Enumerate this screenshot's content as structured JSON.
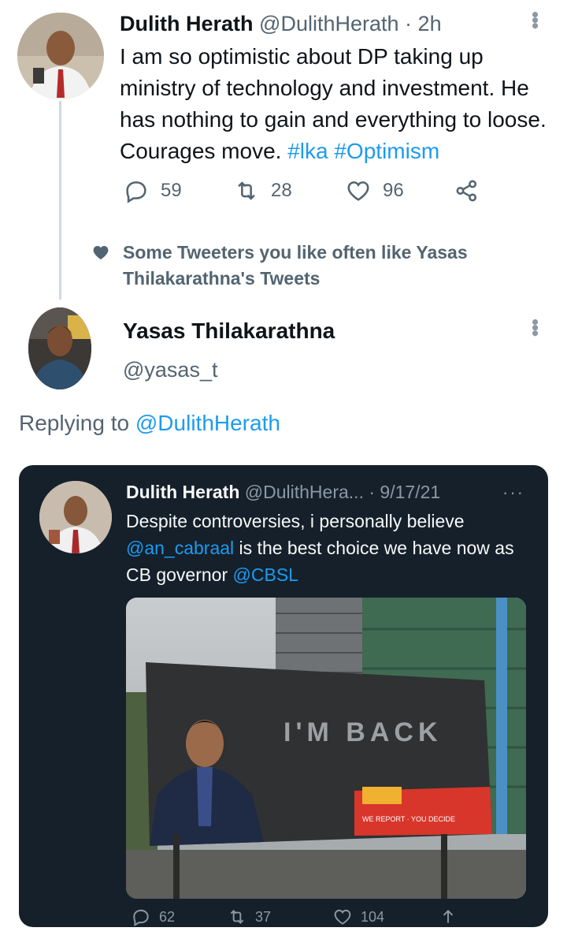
{
  "tweet1": {
    "author_name": "Dulith Herath",
    "author_handle": "@DulithHerath",
    "separator": "·",
    "time": "2h",
    "text_before": "I am so optimistic about DP taking up ministry of technology and investment. He has nothing to gain and everything to loose. Courages move. ",
    "hashtags": "#lka #Optimism",
    "replies": "59",
    "retweets": "28",
    "likes": "96"
  },
  "social_context": {
    "text": "Some Tweeters you like often like Yasas Thilakarathna's Tweets"
  },
  "tweet2": {
    "author_name": "Yasas Thilakarathna",
    "author_handle": "@yasas_t",
    "replying_prefix": "Replying to ",
    "replying_to": "@DulithHerath"
  },
  "embedded": {
    "author_name": "Dulith Herath",
    "author_handle": "@DulithHera...",
    "separator": "·",
    "date": "9/17/21",
    "more": "···",
    "text_1": "Despite controversies, i personally believe ",
    "mention_1": "@an_cabraal",
    "text_2": " is the best choice we have now as CB governor ",
    "mention_2": "@CBSL",
    "billboard_text": "I'M BACK",
    "billboard_tagline": "WE REPORT · YOU DECIDE",
    "replies": "62",
    "retweets": "37",
    "likes": "104"
  },
  "colors": {
    "accent": "#1d9bf0",
    "secondary_text": "#536471",
    "card_bg": "#15202b"
  },
  "icons": [
    "reply-icon",
    "retweet-icon",
    "like-icon",
    "share-icon",
    "heart-icon",
    "more-icon"
  ]
}
